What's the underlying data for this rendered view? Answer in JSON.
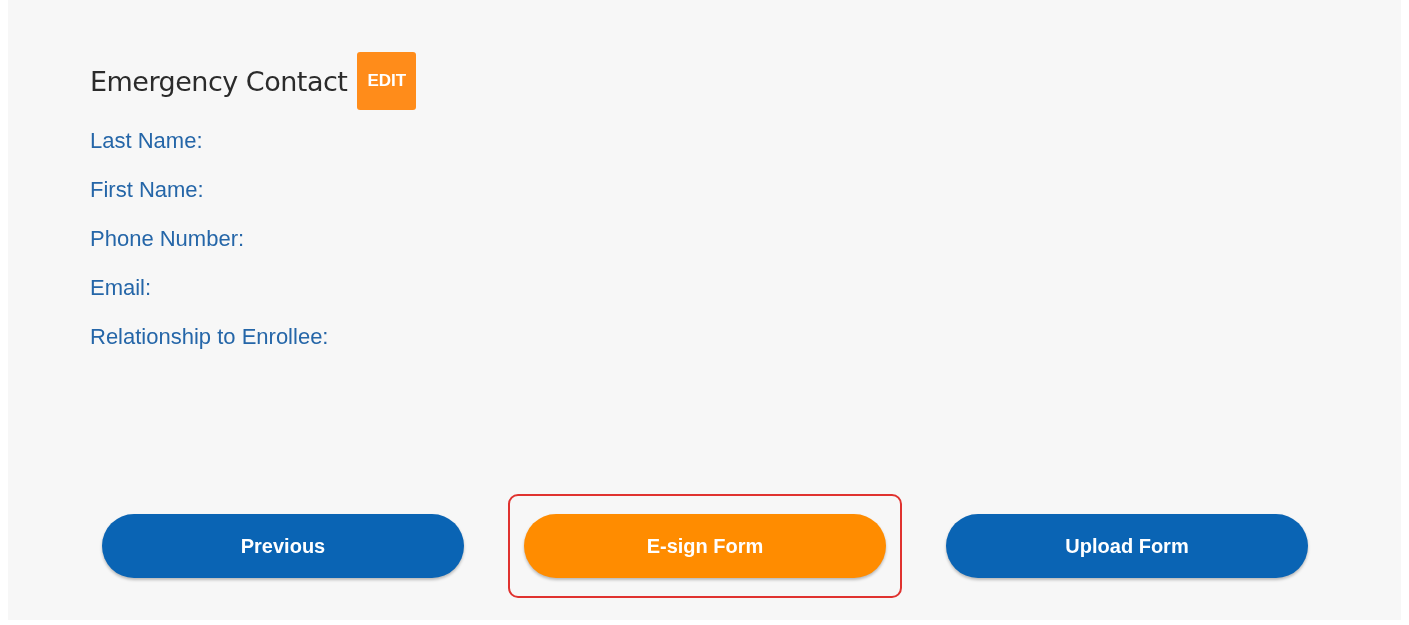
{
  "section": {
    "title": "Emergency Contact",
    "edit_label": "EDIT"
  },
  "fields": [
    "Last Name:",
    "First Name:",
    "Phone Number:",
    "Email:",
    "Relationship to Enrollee:"
  ],
  "buttons": [
    {
      "label": "Previous",
      "kind": "primary",
      "highlighted": false
    },
    {
      "label": "E-sign Form",
      "kind": "accent",
      "highlighted": true
    },
    {
      "label": "Upload Form",
      "kind": "primary",
      "highlighted": false
    }
  ]
}
